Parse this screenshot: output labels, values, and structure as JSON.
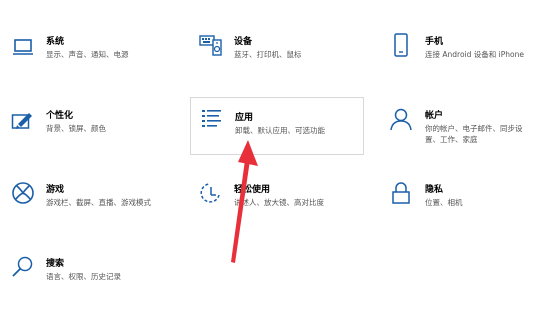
{
  "tiles": [
    {
      "id": "system",
      "title": "系统",
      "desc": [
        "显示、声音、通知、电源"
      ]
    },
    {
      "id": "devices",
      "title": "设备",
      "desc": [
        "蓝牙、打印机、鼠标"
      ]
    },
    {
      "id": "phone",
      "title": "手机",
      "desc": [
        "连接 Android 设备和 iPhone"
      ]
    },
    {
      "id": "personalization",
      "title": "个性化",
      "desc": [
        "背景、锁屏、颜色"
      ]
    },
    {
      "id": "apps",
      "title": "应用",
      "desc": [
        "卸载、默认应用、可选功能"
      ]
    },
    {
      "id": "accounts",
      "title": "帐户",
      "desc": [
        "你的帐户、电子邮件、同步设",
        "置、工作、家庭"
      ]
    },
    {
      "id": "gaming",
      "title": "游戏",
      "desc": [
        "游戏栏、截屏、直播、游戏模式"
      ]
    },
    {
      "id": "ease",
      "title": "轻松使用",
      "desc": [
        "讲述人、放大镜、高对比度"
      ]
    },
    {
      "id": "privacy",
      "title": "隐私",
      "desc": [
        "位置、相机"
      ]
    },
    {
      "id": "search",
      "title": "搜索",
      "desc": [
        "语言、权限、历史记录"
      ]
    }
  ],
  "annotation": {
    "color": "#e8303a"
  },
  "colors": {
    "icon": "#1a5fa8",
    "hover_border": "#d8d8d8"
  }
}
